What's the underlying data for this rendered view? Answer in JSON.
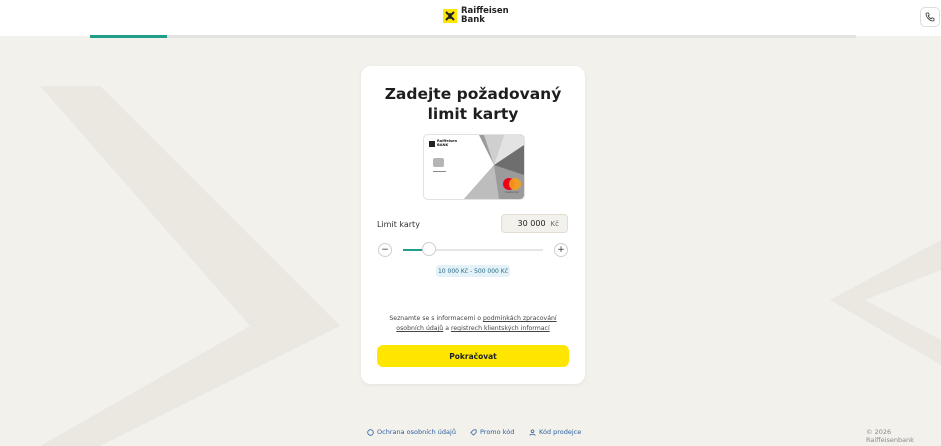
{
  "brand": {
    "line1": "Raiffeisen",
    "line2": "Bank",
    "accent": "#fee600"
  },
  "header": {
    "phone_icon": "phone-icon"
  },
  "progress": {
    "percent": 10,
    "color": "#1f9f8a"
  },
  "main": {
    "title_line1": "Zadejte požadovaný",
    "title_line2": "limit karty",
    "card": {
      "logo_line1": "Raiffeisen",
      "logo_line2": "BANK",
      "network": "mastercard"
    },
    "limit": {
      "label": "Limit karty",
      "value": "30 000",
      "currency": "Kč",
      "minus": "−",
      "plus": "+",
      "slider_fraction": 0.04,
      "range": "10 000 Kč - 500 000 Kč"
    },
    "consent": {
      "text1": "Seznamte se s informacemi o ",
      "link1": "podmínkách zpracování osobních údajů",
      "text2": " a ",
      "link2": "registrech klientských informací"
    },
    "continue_label": "Pokračovat"
  },
  "footer": {
    "links": [
      {
        "label": "Ochrana osobních údajů",
        "icon": "shield-icon"
      },
      {
        "label": "Promo kód",
        "icon": "tag-icon"
      },
      {
        "label": "Kód prodejce",
        "icon": "user-icon"
      }
    ],
    "copyright": "© 2026 Raiffeisenbank"
  }
}
